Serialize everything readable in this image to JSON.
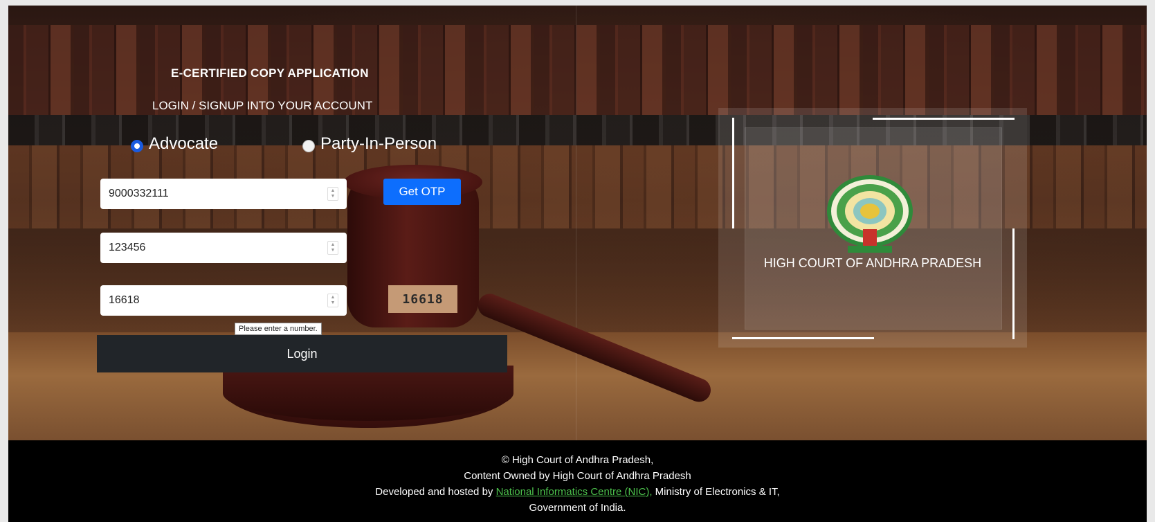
{
  "page": {
    "title": "E-CERTIFIED COPY APPLICATION",
    "subtitle": "LOGIN / SIGNUP INTO YOUR ACCOUNT"
  },
  "user_type": {
    "options": [
      "Advocate",
      "Party-In-Person"
    ],
    "selected": "Advocate"
  },
  "form": {
    "mobile_value": "9000332111",
    "otp_value": "123456",
    "captcha_value": "16618",
    "captcha_image_text": "16618",
    "get_otp_label": "Get OTP",
    "login_label": "Login",
    "validation_tooltip": "Please enter a number."
  },
  "logo_card": {
    "label": "HIGH COURT OF ANDHRA PRADESH",
    "emblem_icon": "ap-high-court-emblem-icon"
  },
  "footer": {
    "line1": "© High Court of Andhra Pradesh,",
    "line2": "Content Owned by High Court of Andhra Pradesh",
    "line3_prefix": "Developed and hosted by",
    "line3_link": "National Informatics Centre (NIC),",
    "line3_suffix": "Ministry of Electronics & IT,",
    "line4": "Government of India."
  },
  "colors": {
    "primary_button": "#0d6efd",
    "login_button": "#212529",
    "footer_bg": "#000000",
    "footer_link": "#4cc14c",
    "captcha_bg": "#c59a76"
  }
}
